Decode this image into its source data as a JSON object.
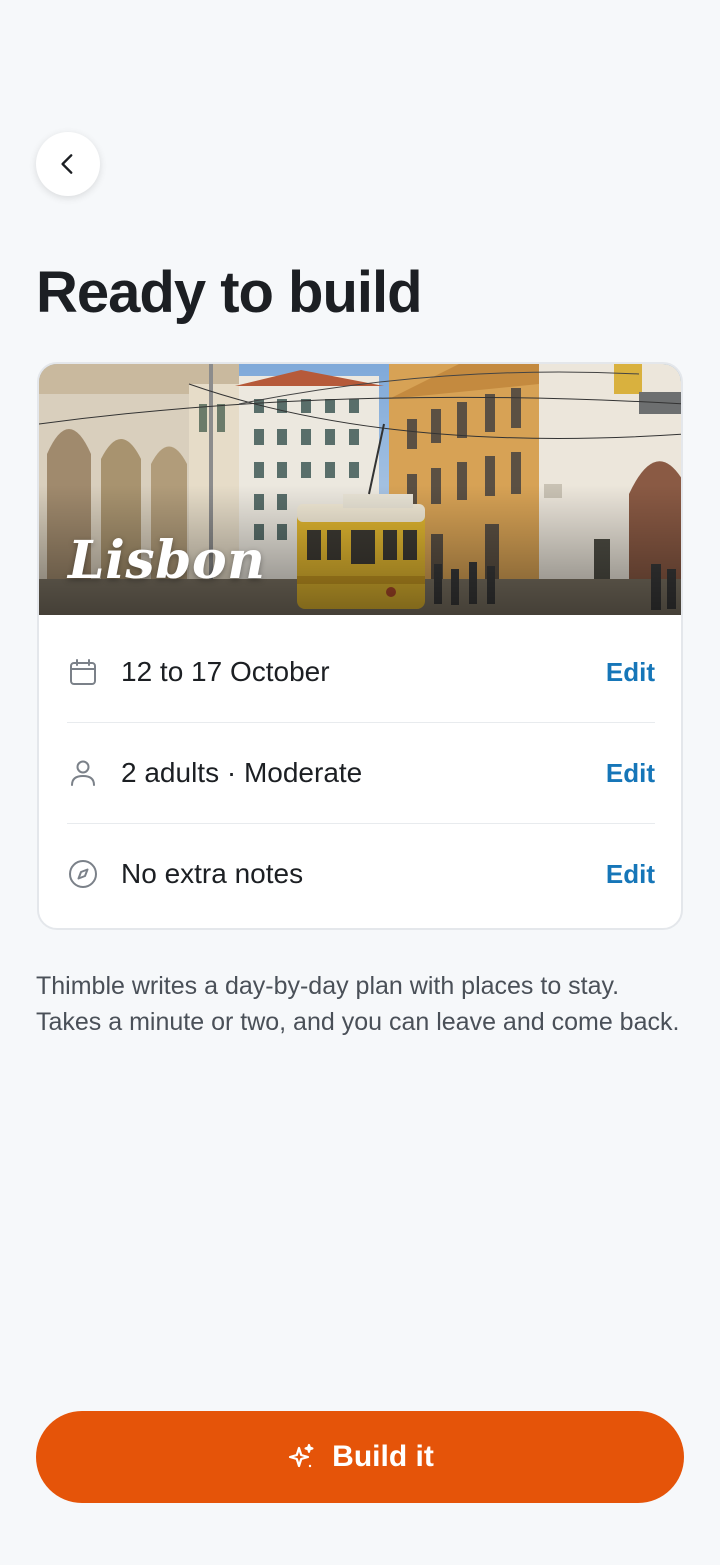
{
  "header": {
    "back_icon": "chevron-left-icon",
    "title": "Ready to build"
  },
  "trip": {
    "city": "Lisbon",
    "rows": [
      {
        "icon": "calendar-icon",
        "label": "12 to 17 October",
        "action": "Edit"
      },
      {
        "icon": "person-icon",
        "label": "2 adults · Moderate",
        "action": "Edit"
      },
      {
        "icon": "compass-icon",
        "label": "No extra notes",
        "action": "Edit"
      }
    ]
  },
  "info": {
    "text": "Thimble writes a day-by-day plan with places to stay. Takes a minute or two, and you can leave and come back."
  },
  "cta": {
    "icon": "sparkle-icon",
    "label": "Build it"
  },
  "colors": {
    "background": "#f6f8fa",
    "accent": "#e55409",
    "link": "#1676b8",
    "text": "#1c1f23"
  }
}
